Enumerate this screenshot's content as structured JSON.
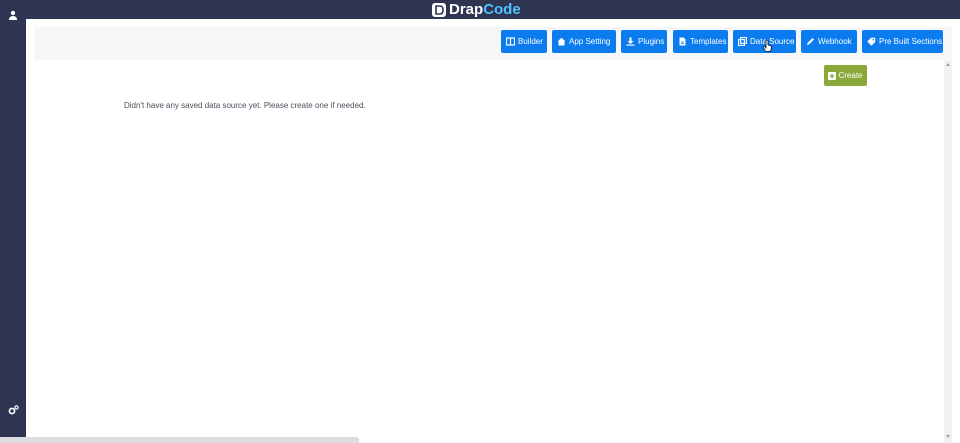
{
  "header": {
    "logo_left": "Drap",
    "logo_right": "Code"
  },
  "sidebar": {
    "icons": [
      "user-icon",
      "gears-icon"
    ]
  },
  "toolbar": {
    "buttons": [
      {
        "label": "Builder",
        "icon": "layout-icon"
      },
      {
        "label": "App Setting",
        "icon": "home-icon"
      },
      {
        "label": "Plugins",
        "icon": "download-icon"
      },
      {
        "label": "Templates",
        "icon": "file-icon"
      },
      {
        "label": "Data Source",
        "icon": "copy-icon"
      },
      {
        "label": "Webhook",
        "icon": "pencil-icon"
      },
      {
        "label": "Pre Built Sections",
        "icon": "tag-icon"
      }
    ]
  },
  "main": {
    "create_label": "Create",
    "empty_message": "Didn't have any saved data source yet. Please create one if needed."
  },
  "colors": {
    "nav_bg": "#2f3453",
    "button_blue": "#0b7cf0",
    "create_green": "#8aa93a",
    "logo_accent": "#4cc3ff"
  }
}
